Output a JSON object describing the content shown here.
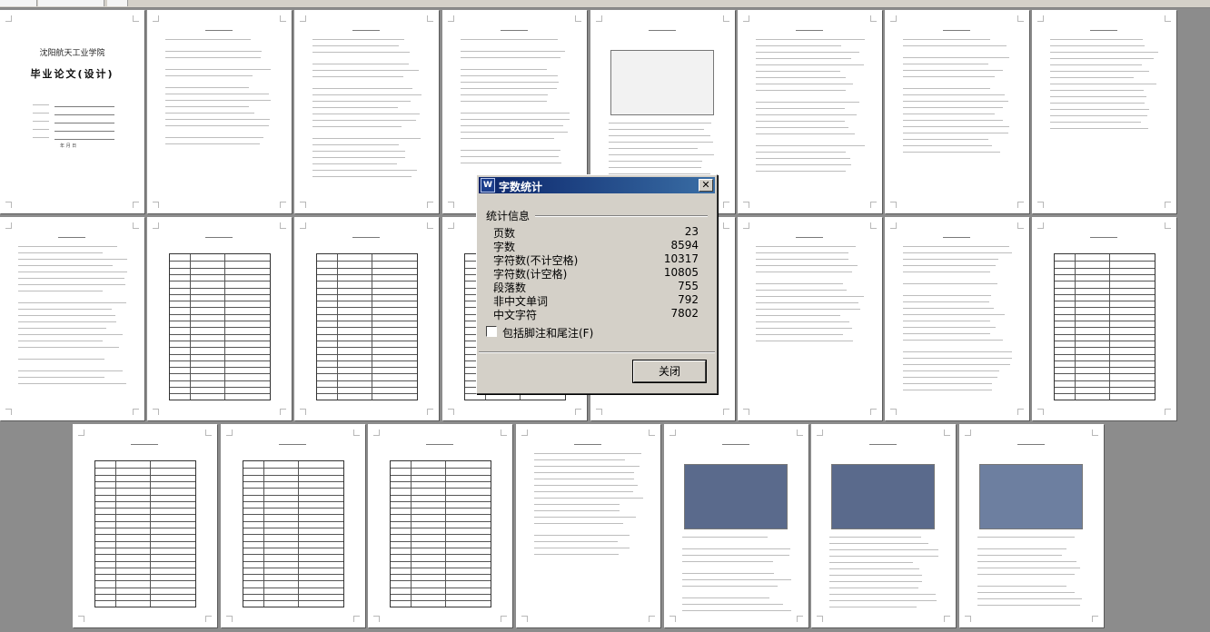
{
  "dialog": {
    "title": "字数统计",
    "app_icon_text": "W",
    "close_symbol": "✕",
    "group_label": "统计信息",
    "stats": [
      {
        "label": "页数",
        "value": "23"
      },
      {
        "label": "字数",
        "value": "8594"
      },
      {
        "label": "字符数(不计空格)",
        "value": "10317"
      },
      {
        "label": "字符数(计空格)",
        "value": "10805"
      },
      {
        "label": "段落数",
        "value": "755"
      },
      {
        "label": "非中文单词",
        "value": "792"
      },
      {
        "label": "中文字符",
        "value": "7802"
      }
    ],
    "checkbox_label": "包括脚注和尾注(F)",
    "checkbox_checked": false,
    "close_button_label": "关闭"
  },
  "document": {
    "cover_school": "沈阳航天工业学院",
    "cover_heading": "毕业论文(设计)",
    "cover_date": "年  月  日",
    "page_count_shown": 23
  },
  "colors": {
    "workspace": "#8c8c8c",
    "dialog_face": "#d4d0c8",
    "title_bar_start": "#0a246a",
    "title_bar_end": "#3a6ea5"
  }
}
